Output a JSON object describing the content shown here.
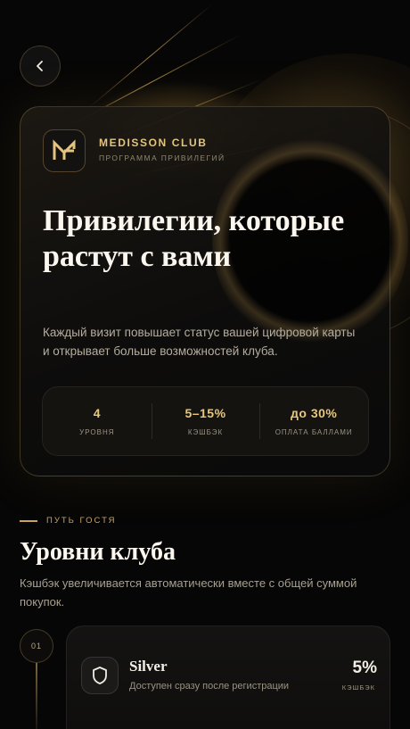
{
  "back_button": {
    "icon": "chevron-left-icon"
  },
  "brand": {
    "name": "MEDISSON CLUB",
    "subtitle": "ПРОГРАММА ПРИВИЛЕГИЙ",
    "logo_icon": "medisson-logo"
  },
  "hero": {
    "title": "Привилегии, которые растут с вами",
    "description": "Каждый визит повышает статус вашей цифровой карты и открывает больше возможностей клуба.",
    "stats": [
      {
        "value": "4",
        "label": "УРОВНЯ"
      },
      {
        "value": "5–15%",
        "label": "КЭШБЭК"
      },
      {
        "value": "до 30%",
        "label": "ОПЛАТА БАЛЛАМИ"
      }
    ]
  },
  "section": {
    "eyebrow": "ПУТЬ ГОСТЯ",
    "title": "Уровни клуба",
    "description": "Кэшбэк увеличивается автоматически вместе с общей суммой покупок."
  },
  "levels": [
    {
      "number": "01",
      "name": "Silver",
      "description": "Доступен сразу после регистрации",
      "value": "5%",
      "value_label": "КЭШБЭК",
      "icon": "shield-icon"
    }
  ],
  "colors": {
    "accent_gold": "#e2c47e",
    "background": "#060606"
  }
}
